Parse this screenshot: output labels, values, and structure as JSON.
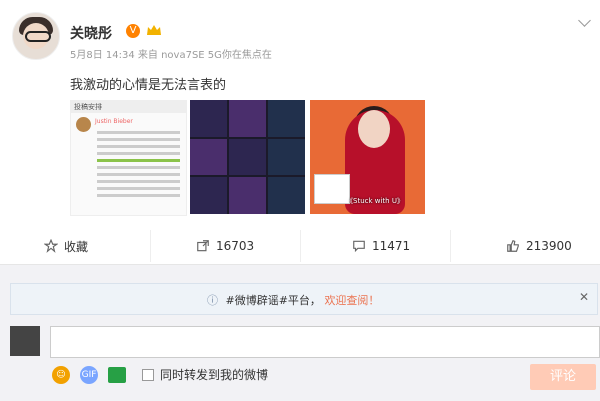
{
  "post": {
    "username": "关晓彤",
    "verified_badge": "V",
    "meta": "5月8日 14:34 来自 nova7SE 5G你在焦点在",
    "text": "我激动的心情是无法言表的",
    "images": [
      {
        "header": "投稿安排",
        "name": "Justin Bieber",
        "lines": 10
      },
      {
        "cells": 9
      },
      {
        "caption": "《Stuck with U》"
      }
    ]
  },
  "actions": {
    "favorite_label": "收藏",
    "repost_count": "16703",
    "comment_count": "11471",
    "like_count": "213900"
  },
  "comment_section": {
    "notice_prefix": "#微博辟谣#平台，",
    "notice_link": "欢迎查阅！",
    "repost_label": "同时转发到我的微博",
    "submit_label": "评论",
    "input_placeholder": ""
  },
  "icons": {
    "gif_text": "GIF",
    "close_glyph": "✕",
    "info_glyph": "ⓘ"
  },
  "colors": {
    "accent": "#eb7350",
    "button_disabled": "#ffcbb6",
    "verified": "#ff8200"
  }
}
